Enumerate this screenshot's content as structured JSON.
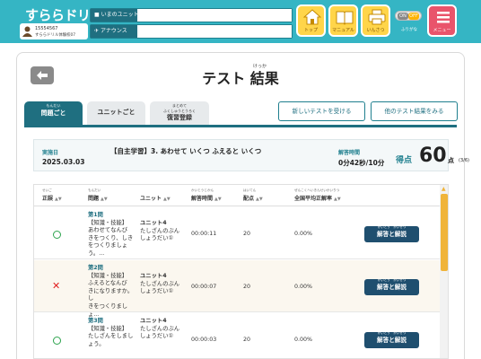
{
  "header": {
    "logo_text": "すららドリル",
    "user_id": "15554567",
    "user_school": "すららドリル体験校07",
    "unit_label": "いまのユニット",
    "notice_label": "アナウンス",
    "nav": [
      {
        "label": "トップ"
      },
      {
        "label": "マニュアル"
      },
      {
        "label": "いんさつ"
      }
    ],
    "toggle_on": "ON",
    "toggle_off": "OFF",
    "toggle_label": "ふりがな",
    "menu_label": "メニュー"
  },
  "page": {
    "title_test": "テスト",
    "title_result": "結果",
    "title_ruby": "けっか"
  },
  "tabs": [
    {
      "ruby": "もんだい",
      "label": "問題ごと"
    },
    {
      "ruby": "",
      "label": "ユニットごと"
    },
    {
      "ruby_top": "まとめて",
      "ruby": "ふくしゅうとうろく",
      "label": "復習登録"
    }
  ],
  "actions": {
    "new_test": "新しいテストを受ける",
    "past_results": "他のテスト結果をみる"
  },
  "summary": {
    "date_label": "実施日",
    "date": "2025.03.03",
    "title": "【自主学習】3. あわせて いくつ ふえると いくつ",
    "time_label": "解答時間",
    "time": "0分42秒/10分",
    "score_label": "得点",
    "score": "60",
    "score_unit": "点",
    "score_fraction": "(3/6)"
  },
  "table": {
    "columns": [
      {
        "ruby": "せいご",
        "label": "正誤"
      },
      {
        "ruby": "もんだい",
        "label": "問題"
      },
      {
        "ruby": "",
        "label": "ユニット"
      },
      {
        "ruby": "かいとうじかん",
        "label": "解答時間"
      },
      {
        "ruby": "はいてん",
        "label": "配点"
      },
      {
        "ruby": "ぜんこくへいきんせいかいりつ",
        "label": "全国平均正解率"
      }
    ],
    "sort_glyph": "▲▼",
    "answer_button": "解答と解説",
    "answer_button_ruby": "かいとう　かいせつ",
    "rows": [
      {
        "correct": true,
        "q_title": "第1問",
        "q_lines": [
          "【知識・技能】",
          "あわせてなんび",
          "きをつくり、しき",
          "をつくりましょう。..."
        ],
        "unit_name": "ユニット4",
        "unit_sub": [
          "たしざんのぶん",
          "しょうだい①"
        ],
        "time": "00:00:11",
        "points": "20",
        "avg_rate": "0.00%"
      },
      {
        "correct": false,
        "q_title": "第2問",
        "q_lines": [
          "【知識・技能】",
          "ふえるとなんび",
          "きになりますか。し",
          "きをつくりましょ..."
        ],
        "unit_name": "ユニット4",
        "unit_sub": [
          "たしざんのぶん",
          "しょうだい①"
        ],
        "time": "00:00:07",
        "points": "20",
        "avg_rate": "0.00%"
      },
      {
        "correct": true,
        "q_title": "第3問",
        "q_lines": [
          "【知識・技能】",
          "たしざんをしまし",
          "ょう。"
        ],
        "unit_name": "ユニット4",
        "unit_sub": [
          "たしざんのぶん",
          "しょうだい①"
        ],
        "time": "00:00:03",
        "points": "20",
        "avg_rate": "0.00%"
      }
    ]
  }
}
